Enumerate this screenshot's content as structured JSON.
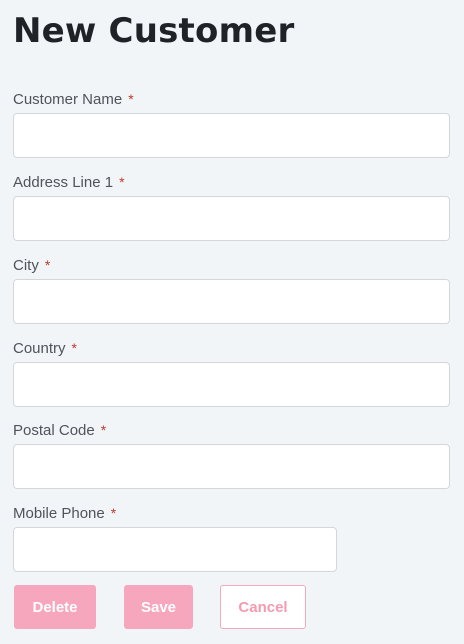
{
  "page": {
    "title": "New Customer"
  },
  "form": {
    "required_marker": "*",
    "fields": [
      {
        "label": "Customer Name",
        "value": "",
        "placeholder": ""
      },
      {
        "label": "Address Line 1",
        "value": "",
        "placeholder": ""
      },
      {
        "label": "City",
        "value": "",
        "placeholder": ""
      },
      {
        "label": "Country",
        "value": "",
        "placeholder": ""
      },
      {
        "label": "Postal Code",
        "value": "",
        "placeholder": ""
      },
      {
        "label": "Mobile Phone",
        "value": "",
        "placeholder": ""
      }
    ]
  },
  "actions": {
    "delete_label": "Delete",
    "save_label": "Save",
    "cancel_label": "Cancel"
  },
  "colors": {
    "background": "#f2f5f8",
    "accent": "#f7a7bd",
    "required": "#c0392b"
  }
}
